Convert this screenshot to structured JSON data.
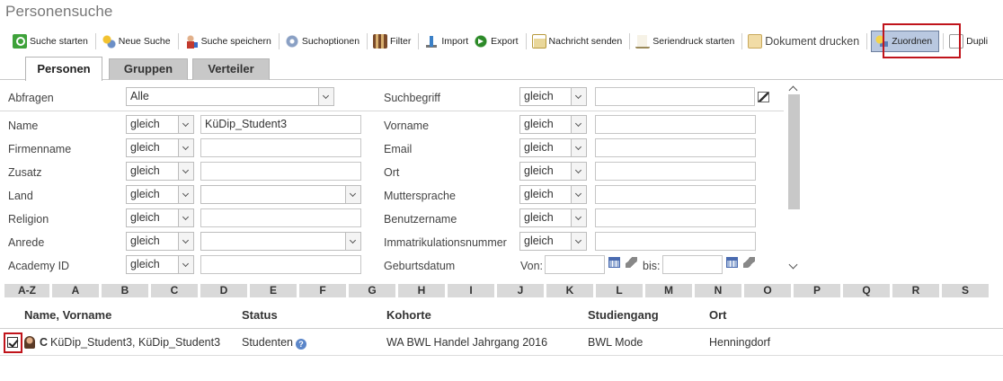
{
  "page": {
    "title": "Personensuche"
  },
  "toolbar": {
    "items": [
      {
        "label": "Suche starten",
        "icon": "search-start-icon"
      },
      {
        "label": "Neue Suche",
        "icon": "new-search-icon"
      },
      {
        "label": "Suche speichern",
        "icon": "save-search-icon"
      },
      {
        "label": "Suchoptionen",
        "icon": "gear-icon"
      },
      {
        "label": "Filter",
        "icon": "filter-icon"
      },
      {
        "label": "Import",
        "icon": "import-icon"
      },
      {
        "label": "Export",
        "icon": "export-icon"
      },
      {
        "label": "Nachricht senden",
        "icon": "mail-icon"
      },
      {
        "label": "Seriendruck starten",
        "icon": "print-icon"
      },
      {
        "label": "Dokument drucken",
        "icon": "document-icon"
      },
      {
        "label": "Zuordnen",
        "icon": "assign-icon",
        "selected": true
      },
      {
        "label": "Dupli",
        "icon": "duplicate-icon"
      }
    ]
  },
  "tabs": [
    {
      "label": "Personen",
      "active": true
    },
    {
      "label": "Gruppen",
      "active": false
    },
    {
      "label": "Verteiler",
      "active": false
    }
  ],
  "form": {
    "abfragen": {
      "label": "Abfragen",
      "value": "Alle"
    },
    "suchbegriff": {
      "label": "Suchbegriff",
      "operator": "gleich",
      "value": ""
    },
    "left_fields": [
      {
        "label": "Name",
        "operator": "gleich",
        "value": "KüDip_Student3",
        "type": "text"
      },
      {
        "label": "Firmenname",
        "operator": "gleich",
        "value": "",
        "type": "text"
      },
      {
        "label": "Zusatz",
        "operator": "gleich",
        "value": "",
        "type": "text"
      },
      {
        "label": "Land",
        "operator": "gleich",
        "value": "",
        "type": "select"
      },
      {
        "label": "Religion",
        "operator": "gleich",
        "value": "",
        "type": "text"
      },
      {
        "label": "Anrede",
        "operator": "gleich",
        "value": "",
        "type": "select"
      },
      {
        "label": "Academy ID",
        "operator": "gleich",
        "value": "",
        "type": "text"
      }
    ],
    "right_fields": [
      {
        "label": "Vorname",
        "operator": "gleich",
        "value": ""
      },
      {
        "label": "Email",
        "operator": "gleich",
        "value": ""
      },
      {
        "label": "Ort",
        "operator": "gleich",
        "value": ""
      },
      {
        "label": "Muttersprache",
        "operator": "gleich",
        "value": ""
      },
      {
        "label": "Benutzername",
        "operator": "gleich",
        "value": ""
      },
      {
        "label": "Immatrikulationsnummer",
        "operator": "gleich",
        "value": ""
      }
    ],
    "geburtsdatum": {
      "label": "Geburtsdatum",
      "from_label": "Von:",
      "to_label": "bis:",
      "from": "",
      "to": ""
    }
  },
  "alphabet": [
    "A-Z",
    "A",
    "B",
    "C",
    "D",
    "E",
    "F",
    "G",
    "H",
    "I",
    "J",
    "K",
    "L",
    "M",
    "N",
    "O",
    "P",
    "Q",
    "R",
    "S"
  ],
  "results": {
    "columns": [
      "Name, Vorname",
      "Status",
      "Kohorte",
      "Studiengang",
      "Ort"
    ],
    "rows": [
      {
        "checked": true,
        "prefix": "C",
        "name": "KüDip_Student3, KüDip_Student3",
        "status": "Studenten",
        "kohorte": "WA BWL Handel Jahrgang 2016",
        "studiengang": "BWL Mode",
        "ort": "Henningdorf"
      }
    ]
  },
  "colors": {
    "highlight_border": "#c0141b",
    "selected_button": "#b9c8e0",
    "tab_inactive": "#c8c8c8"
  }
}
